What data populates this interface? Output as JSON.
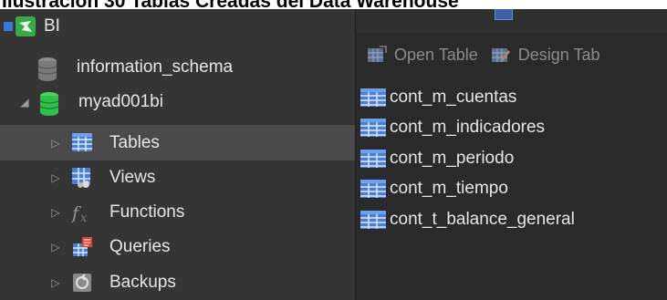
{
  "caption": "Ilustración 30 Tablas Creadas del Data Warehouse",
  "sidebar": {
    "connection": {
      "label": "BI"
    },
    "databases": [
      {
        "label": "information_schema"
      },
      {
        "label": "myad001bi"
      }
    ],
    "nodes": [
      {
        "label": "Tables",
        "icon": "table-icon",
        "selected": true
      },
      {
        "label": "Views",
        "icon": "view-icon"
      },
      {
        "label": "Functions",
        "icon": "function-icon"
      },
      {
        "label": "Queries",
        "icon": "query-icon"
      },
      {
        "label": "Backups",
        "icon": "backup-icon"
      }
    ]
  },
  "toolbar": {
    "open_table_label": "Open Table",
    "design_table_label": "Design Tab"
  },
  "tables": [
    "cont_m_cuentas",
    "cont_m_indicadores",
    "cont_m_periodo",
    "cont_m_tiempo",
    "cont_t_balance_general"
  ],
  "colors": {
    "sidebar_bg": "#353535",
    "main_bg": "#2a2a2a",
    "selected_row": "#4a4a4a",
    "db_green": "#2fbf4a",
    "table_blue": "#4a7fd6",
    "connection_green": "#39a948"
  }
}
